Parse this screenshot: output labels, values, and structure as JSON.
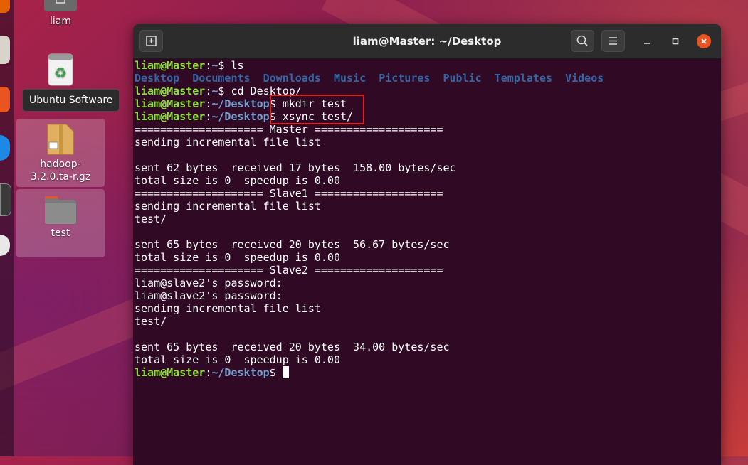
{
  "desktop": {
    "icons": [
      {
        "id": "home",
        "label": "liam"
      },
      {
        "id": "trash",
        "label": ""
      },
      {
        "id": "archive",
        "label": "hadoop-3.2.0.ta-r.gz"
      },
      {
        "id": "folder",
        "label": "test"
      }
    ],
    "tooltip": "Ubuntu Software"
  },
  "terminal": {
    "title": "liam@Master: ~/Desktop",
    "lines": [
      [
        {
          "t": "liam@Master",
          "c": "u"
        },
        {
          "t": ":"
        },
        {
          "t": "~",
          "c": "p"
        },
        {
          "t": "$ ls"
        }
      ],
      [
        {
          "t": "Desktop",
          "c": "d"
        },
        {
          "t": "  "
        },
        {
          "t": "Documents",
          "c": "d"
        },
        {
          "t": "  "
        },
        {
          "t": "Downloads",
          "c": "d"
        },
        {
          "t": "  "
        },
        {
          "t": "Music",
          "c": "d"
        },
        {
          "t": "  "
        },
        {
          "t": "Pictures",
          "c": "d"
        },
        {
          "t": "  "
        },
        {
          "t": "Public",
          "c": "d"
        },
        {
          "t": "  "
        },
        {
          "t": "Templates",
          "c": "d"
        },
        {
          "t": "  "
        },
        {
          "t": "Videos",
          "c": "d"
        }
      ],
      [
        {
          "t": "liam@Master",
          "c": "u"
        },
        {
          "t": ":"
        },
        {
          "t": "~",
          "c": "p"
        },
        {
          "t": "$ cd Desktop/"
        }
      ],
      [
        {
          "t": "liam@Master",
          "c": "u"
        },
        {
          "t": ":"
        },
        {
          "t": "~/Desktop",
          "c": "p"
        },
        {
          "t": "$ mkdir test"
        }
      ],
      [
        {
          "t": "liam@Master",
          "c": "u"
        },
        {
          "t": ":"
        },
        {
          "t": "~/Desktop",
          "c": "p"
        },
        {
          "t": "$ xsync test/"
        }
      ],
      [
        {
          "t": "==================== Master ===================="
        }
      ],
      [
        {
          "t": "sending incremental file list"
        }
      ],
      [
        {
          "t": ""
        }
      ],
      [
        {
          "t": "sent 62 bytes  received 17 bytes  158.00 bytes/sec"
        }
      ],
      [
        {
          "t": "total size is 0  speedup is 0.00"
        }
      ],
      [
        {
          "t": "==================== Slave1 ===================="
        }
      ],
      [
        {
          "t": "sending incremental file list"
        }
      ],
      [
        {
          "t": "test/"
        }
      ],
      [
        {
          "t": ""
        }
      ],
      [
        {
          "t": "sent 65 bytes  received 20 bytes  56.67 bytes/sec"
        }
      ],
      [
        {
          "t": "total size is 0  speedup is 0.00"
        }
      ],
      [
        {
          "t": "==================== Slave2 ===================="
        }
      ],
      [
        {
          "t": "liam@slave2's password:"
        }
      ],
      [
        {
          "t": "liam@slave2's password:"
        }
      ],
      [
        {
          "t": "sending incremental file list"
        }
      ],
      [
        {
          "t": "test/"
        }
      ],
      [
        {
          "t": ""
        }
      ],
      [
        {
          "t": "sent 65 bytes  received 20 bytes  34.00 bytes/sec"
        }
      ],
      [
        {
          "t": "total size is 0  speedup is 0.00"
        }
      ],
      [
        {
          "t": "liam@Master",
          "c": "u"
        },
        {
          "t": ":"
        },
        {
          "t": "~/Desktop",
          "c": "p"
        },
        {
          "t": "$ "
        }
      ]
    ]
  },
  "colors": {
    "prompt_user": "#8ae234",
    "prompt_path": "#729fcf",
    "dir": "#3465a4",
    "terminal_bg": "#300a24",
    "annotation": "#e0201f"
  }
}
